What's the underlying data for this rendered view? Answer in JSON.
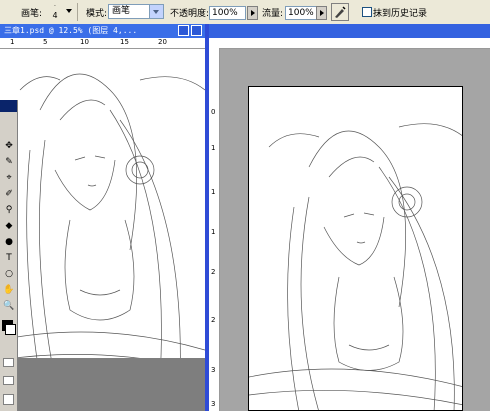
{
  "options_bar": {
    "brush_label": "画笔:",
    "brush_size": "4",
    "mode_label": "模式:",
    "mode_value": "画笔",
    "opacity_label": "不透明度:",
    "opacity_value": "100%",
    "flow_label": "流量:",
    "flow_value": "100%",
    "erase_history_label": "抹到历史记录",
    "erase_history_checked": false
  },
  "left_document": {
    "title": "三章1.psd @ 12.5% (图层 4,...",
    "ruler_top": [
      "1",
      "5",
      "10",
      "15",
      "20"
    ]
  },
  "right_document": {
    "ruler_left": [
      "0",
      "1",
      "1",
      "1",
      "2",
      "2",
      "3",
      "3"
    ]
  },
  "tools": [
    "✥",
    "✎",
    "⌖",
    "✐",
    "⚲",
    "◆",
    "●",
    "T",
    "○",
    "✋",
    "🔍"
  ]
}
